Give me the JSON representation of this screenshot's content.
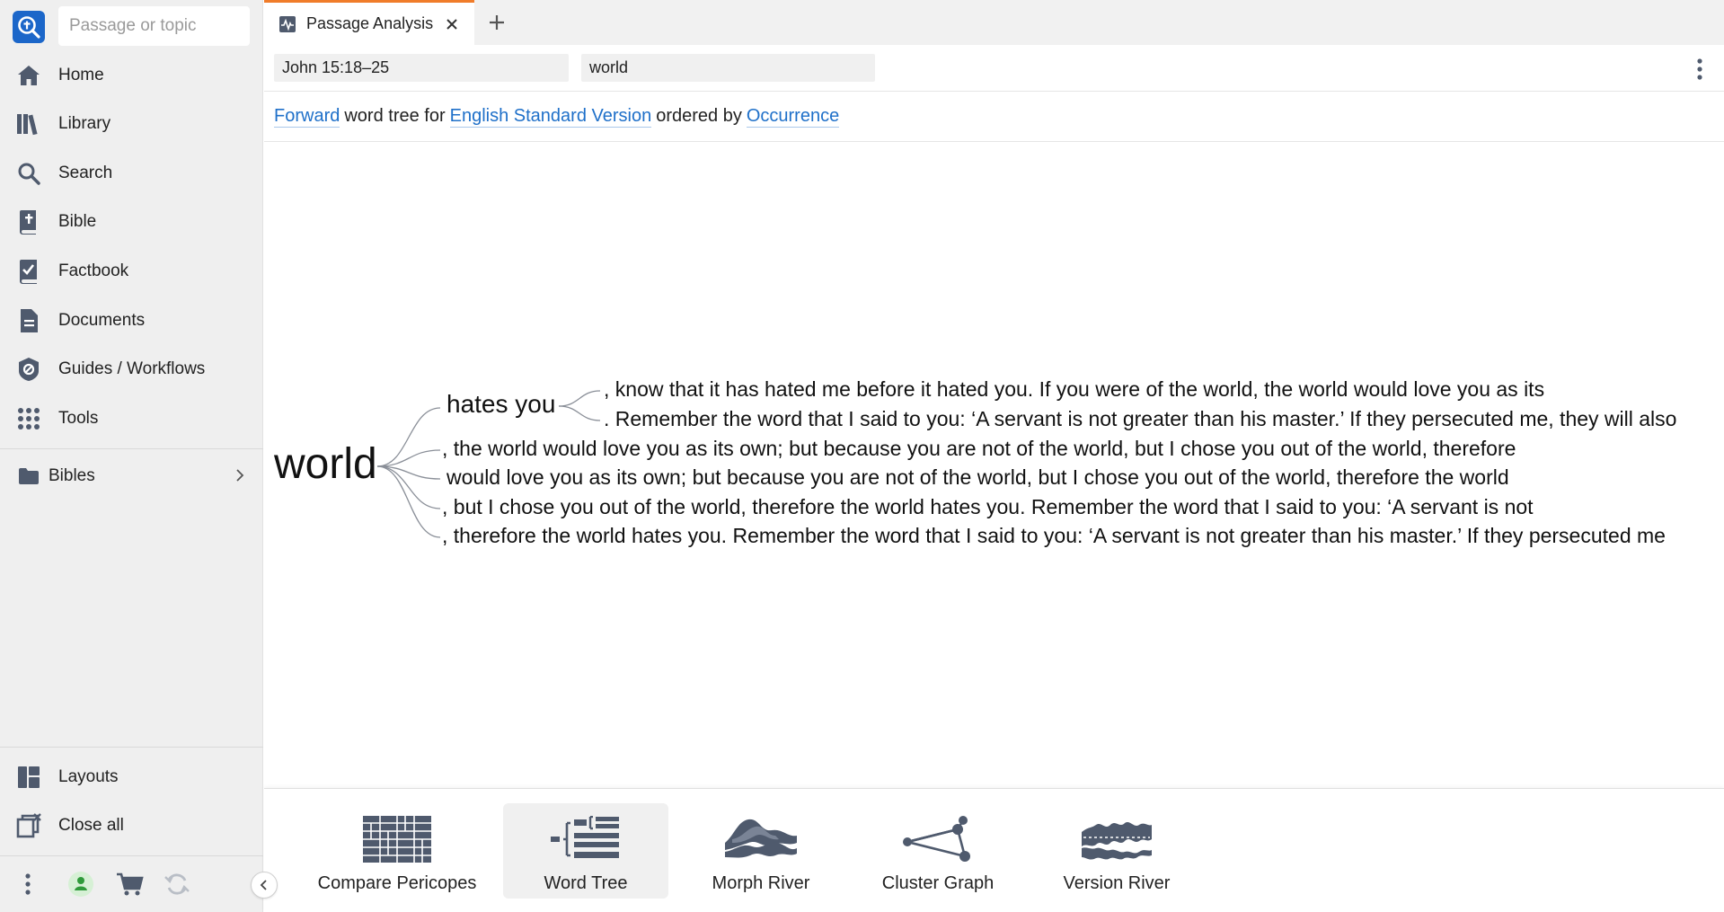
{
  "sidebar": {
    "search_placeholder": "Passage or topic",
    "nav": [
      {
        "label": "Home",
        "icon": "home-icon"
      },
      {
        "label": "Library",
        "icon": "library-icon"
      },
      {
        "label": "Search",
        "icon": "search-icon"
      },
      {
        "label": "Bible",
        "icon": "bible-icon"
      },
      {
        "label": "Factbook",
        "icon": "factbook-icon"
      },
      {
        "label": "Documents",
        "icon": "documents-icon"
      },
      {
        "label": "Guides / Workflows",
        "icon": "guides-icon"
      },
      {
        "label": "Tools",
        "icon": "tools-icon"
      }
    ],
    "bibles_label": "Bibles",
    "layouts_label": "Layouts",
    "close_all_label": "Close all"
  },
  "tab": {
    "title": "Passage Analysis"
  },
  "toolbar": {
    "reference_value": "John 15:18–25",
    "word_value": "world"
  },
  "settings": {
    "direction": "Forward",
    "text1": "word tree for",
    "version": "English Standard Version",
    "text2": "ordered by",
    "order": "Occurrence"
  },
  "word_tree": {
    "root": "world",
    "branches": [
      {
        "text": "hates you",
        "children": [
          ", know that it has hated me before it hated you. If you were of the world, the world would love you as its",
          ". Remember the word that I said to you: ‘A servant is not greater than his master.’ If they persecuted me, they will also"
        ]
      },
      {
        "text": ", the world would love you as its own; but because you are not of the world, but I chose you out of the world, therefore"
      },
      {
        "text": "would love you as its own; but because you are not of the world, but I chose you out of the world, therefore the world"
      },
      {
        "text": ", but I chose you out of the world, therefore the world hates you. Remember the word that I said to you: ‘A servant is not"
      },
      {
        "text": ", therefore the world hates you. Remember the word that I said to you: ‘A servant is not greater than his master.’ If they persecuted me"
      }
    ]
  },
  "visualizations": [
    {
      "label": "Compare Pericopes",
      "icon": "compare-pericopes-icon",
      "selected": false
    },
    {
      "label": "Word Tree",
      "icon": "word-tree-icon",
      "selected": true
    },
    {
      "label": "Morph River",
      "icon": "morph-river-icon",
      "selected": false
    },
    {
      "label": "Cluster Graph",
      "icon": "cluster-graph-icon",
      "selected": false
    },
    {
      "label": "Version River",
      "icon": "version-river-icon",
      "selected": false
    }
  ],
  "colors": {
    "accent_tab": "#f07c2a",
    "link": "#1f70c9",
    "icon": "#4f5a6d",
    "logo": "#1b66c9"
  }
}
